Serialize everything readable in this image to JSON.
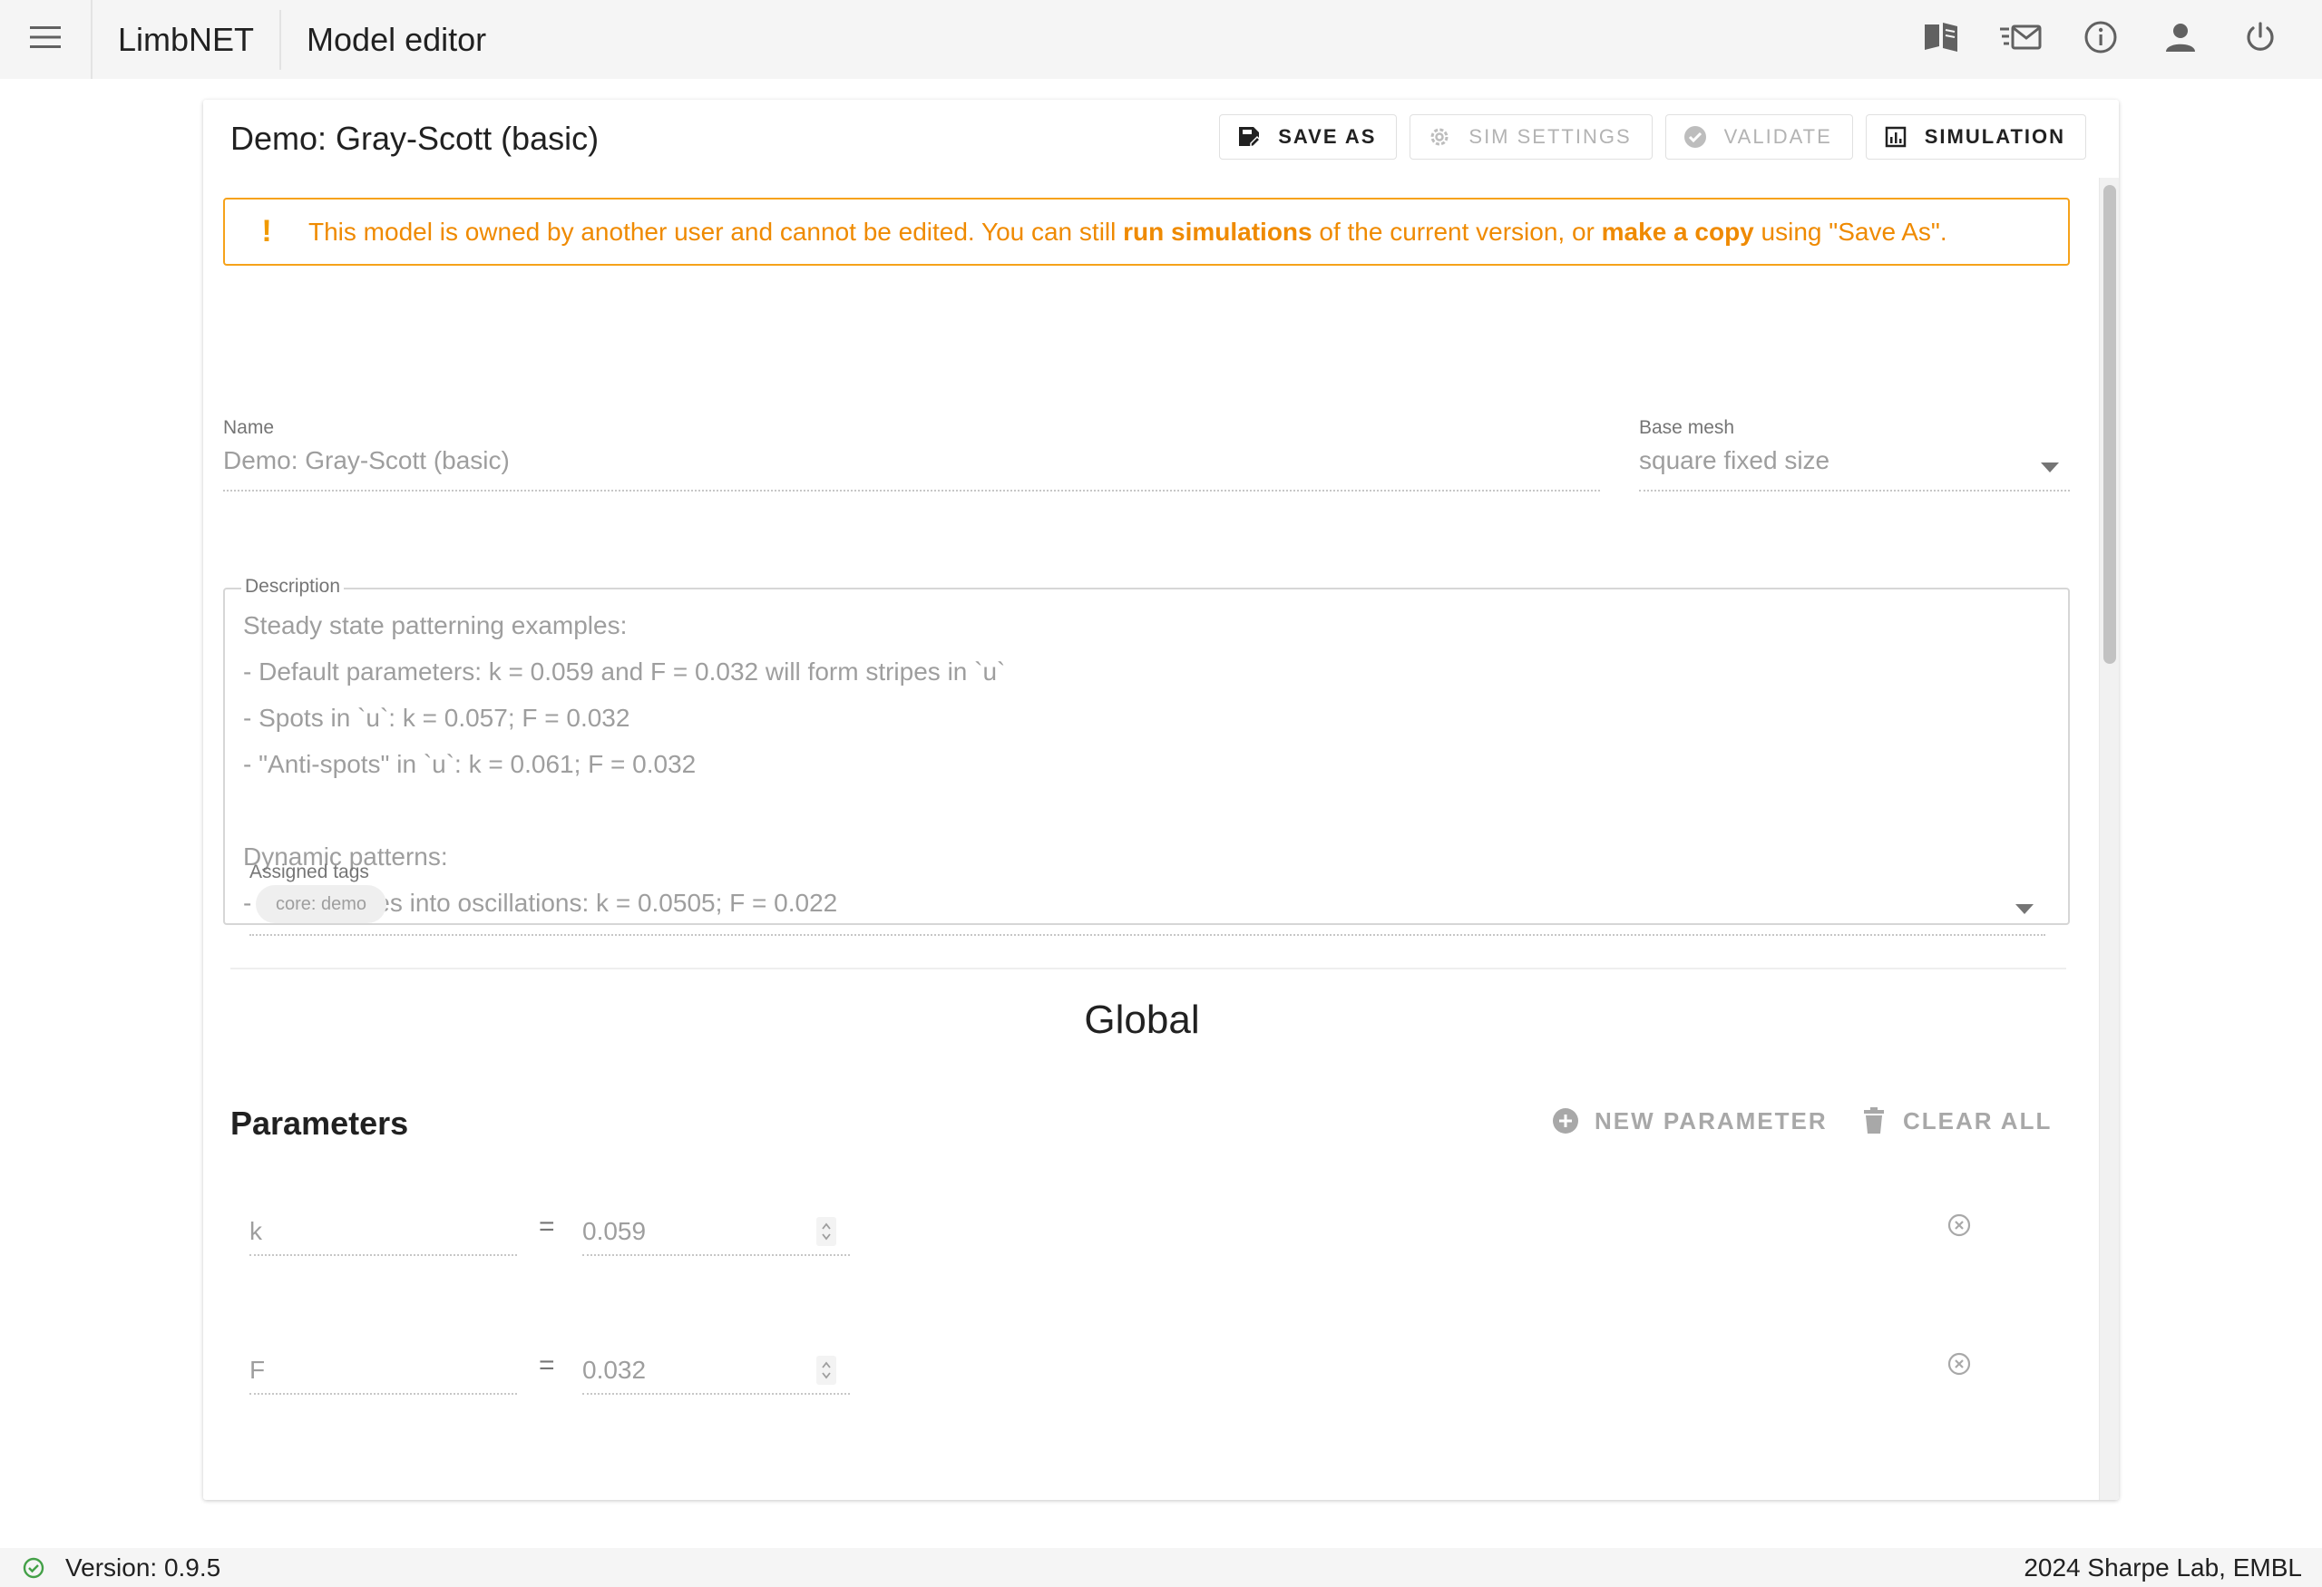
{
  "appbar": {
    "app_name": "LimbNET",
    "page_title": "Model editor",
    "icons": [
      "menu-icon",
      "book-icon",
      "mail-icon",
      "info-icon",
      "account-icon",
      "power-icon"
    ]
  },
  "card": {
    "title": "Demo: Gray-Scott (basic)",
    "toolbar": {
      "save_as": "SAVE AS",
      "sim_settings": "SIM SETTINGS",
      "validate": "VALIDATE",
      "simulation": "SIMULATION"
    },
    "alert": {
      "text_1": "This model is owned by another user and cannot be edited. You can still ",
      "bold_1": "run simulations",
      "text_2": " of the current version, or ",
      "bold_2": "make a copy",
      "text_3": " using \"Save As\".",
      "color": "#ef8a00"
    },
    "name_field": {
      "label": "Name",
      "value": "Demo: Gray-Scott (basic)"
    },
    "base_mesh": {
      "label": "Base mesh",
      "value": "square fixed size"
    },
    "description": {
      "label": "Description",
      "lines": [
        "Steady state patterning examples:",
        "- Default parameters: k = 0.059 and F = 0.032 will form stripes in `u`",
        "- Spots in `u`: k = 0.057; F = 0.032",
        "- \"Anti-spots\" in `u`: k = 0.061; F = 0.032",
        "",
        "Dynamic patterns:",
        "- Spiral waves into oscillations: k = 0.0505; F = 0.022"
      ]
    },
    "tags": {
      "label": "Assigned tags",
      "chips": [
        "core: demo"
      ]
    },
    "section_title": "Global",
    "parameters": {
      "title": "Parameters",
      "new_label": "NEW PARAMETER",
      "clear_label": "CLEAR ALL",
      "eq": "=",
      "rows": [
        {
          "name": "k",
          "value": "0.059"
        },
        {
          "name": "F",
          "value": "0.032"
        }
      ]
    }
  },
  "footer": {
    "version": "Version: 0.9.5",
    "credit": "2024 Sharpe Lab, EMBL",
    "status_color": "#43a047"
  }
}
